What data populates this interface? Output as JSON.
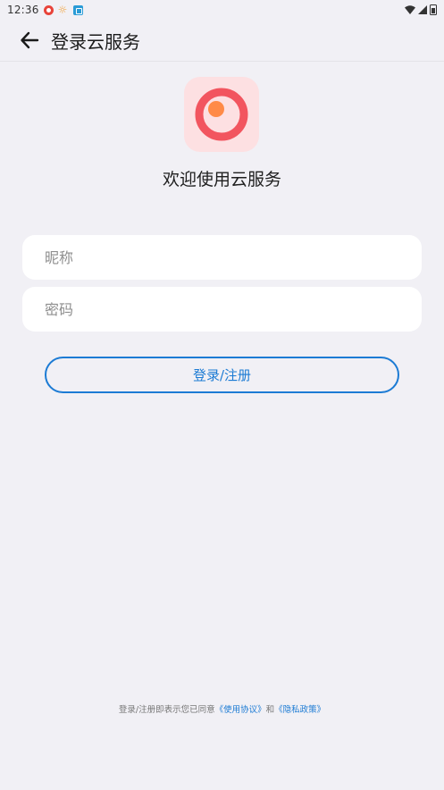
{
  "status_bar": {
    "time": "12:36",
    "icons": [
      "app-notification-icon",
      "weather-sun-icon",
      "app-chat-icon",
      "wifi-icon",
      "cellular-signal-icon",
      "battery-icon"
    ]
  },
  "app_bar": {
    "title": "登录云服务",
    "back_icon": "arrow-left-icon"
  },
  "logo": {
    "icon": "cloud-service-logo-icon",
    "ring_color": "#f2555f",
    "accent_color": "#ff8a47",
    "background_color": "#fde0e2"
  },
  "welcome_text": "欢迎使用云服务",
  "form": {
    "nickname_placeholder": "昵称",
    "nickname_value": "",
    "password_placeholder": "密码",
    "password_value": "",
    "submit_label": "登录/注册"
  },
  "footer": {
    "prefix": "登录/注册即表示您已同意",
    "terms_link": "《使用协议》",
    "conjunction": "和",
    "privacy_link": "《隐私政策》"
  },
  "colors": {
    "accent": "#1c7bd4",
    "background": "#f1f0f5",
    "input_background": "#ffffff"
  }
}
